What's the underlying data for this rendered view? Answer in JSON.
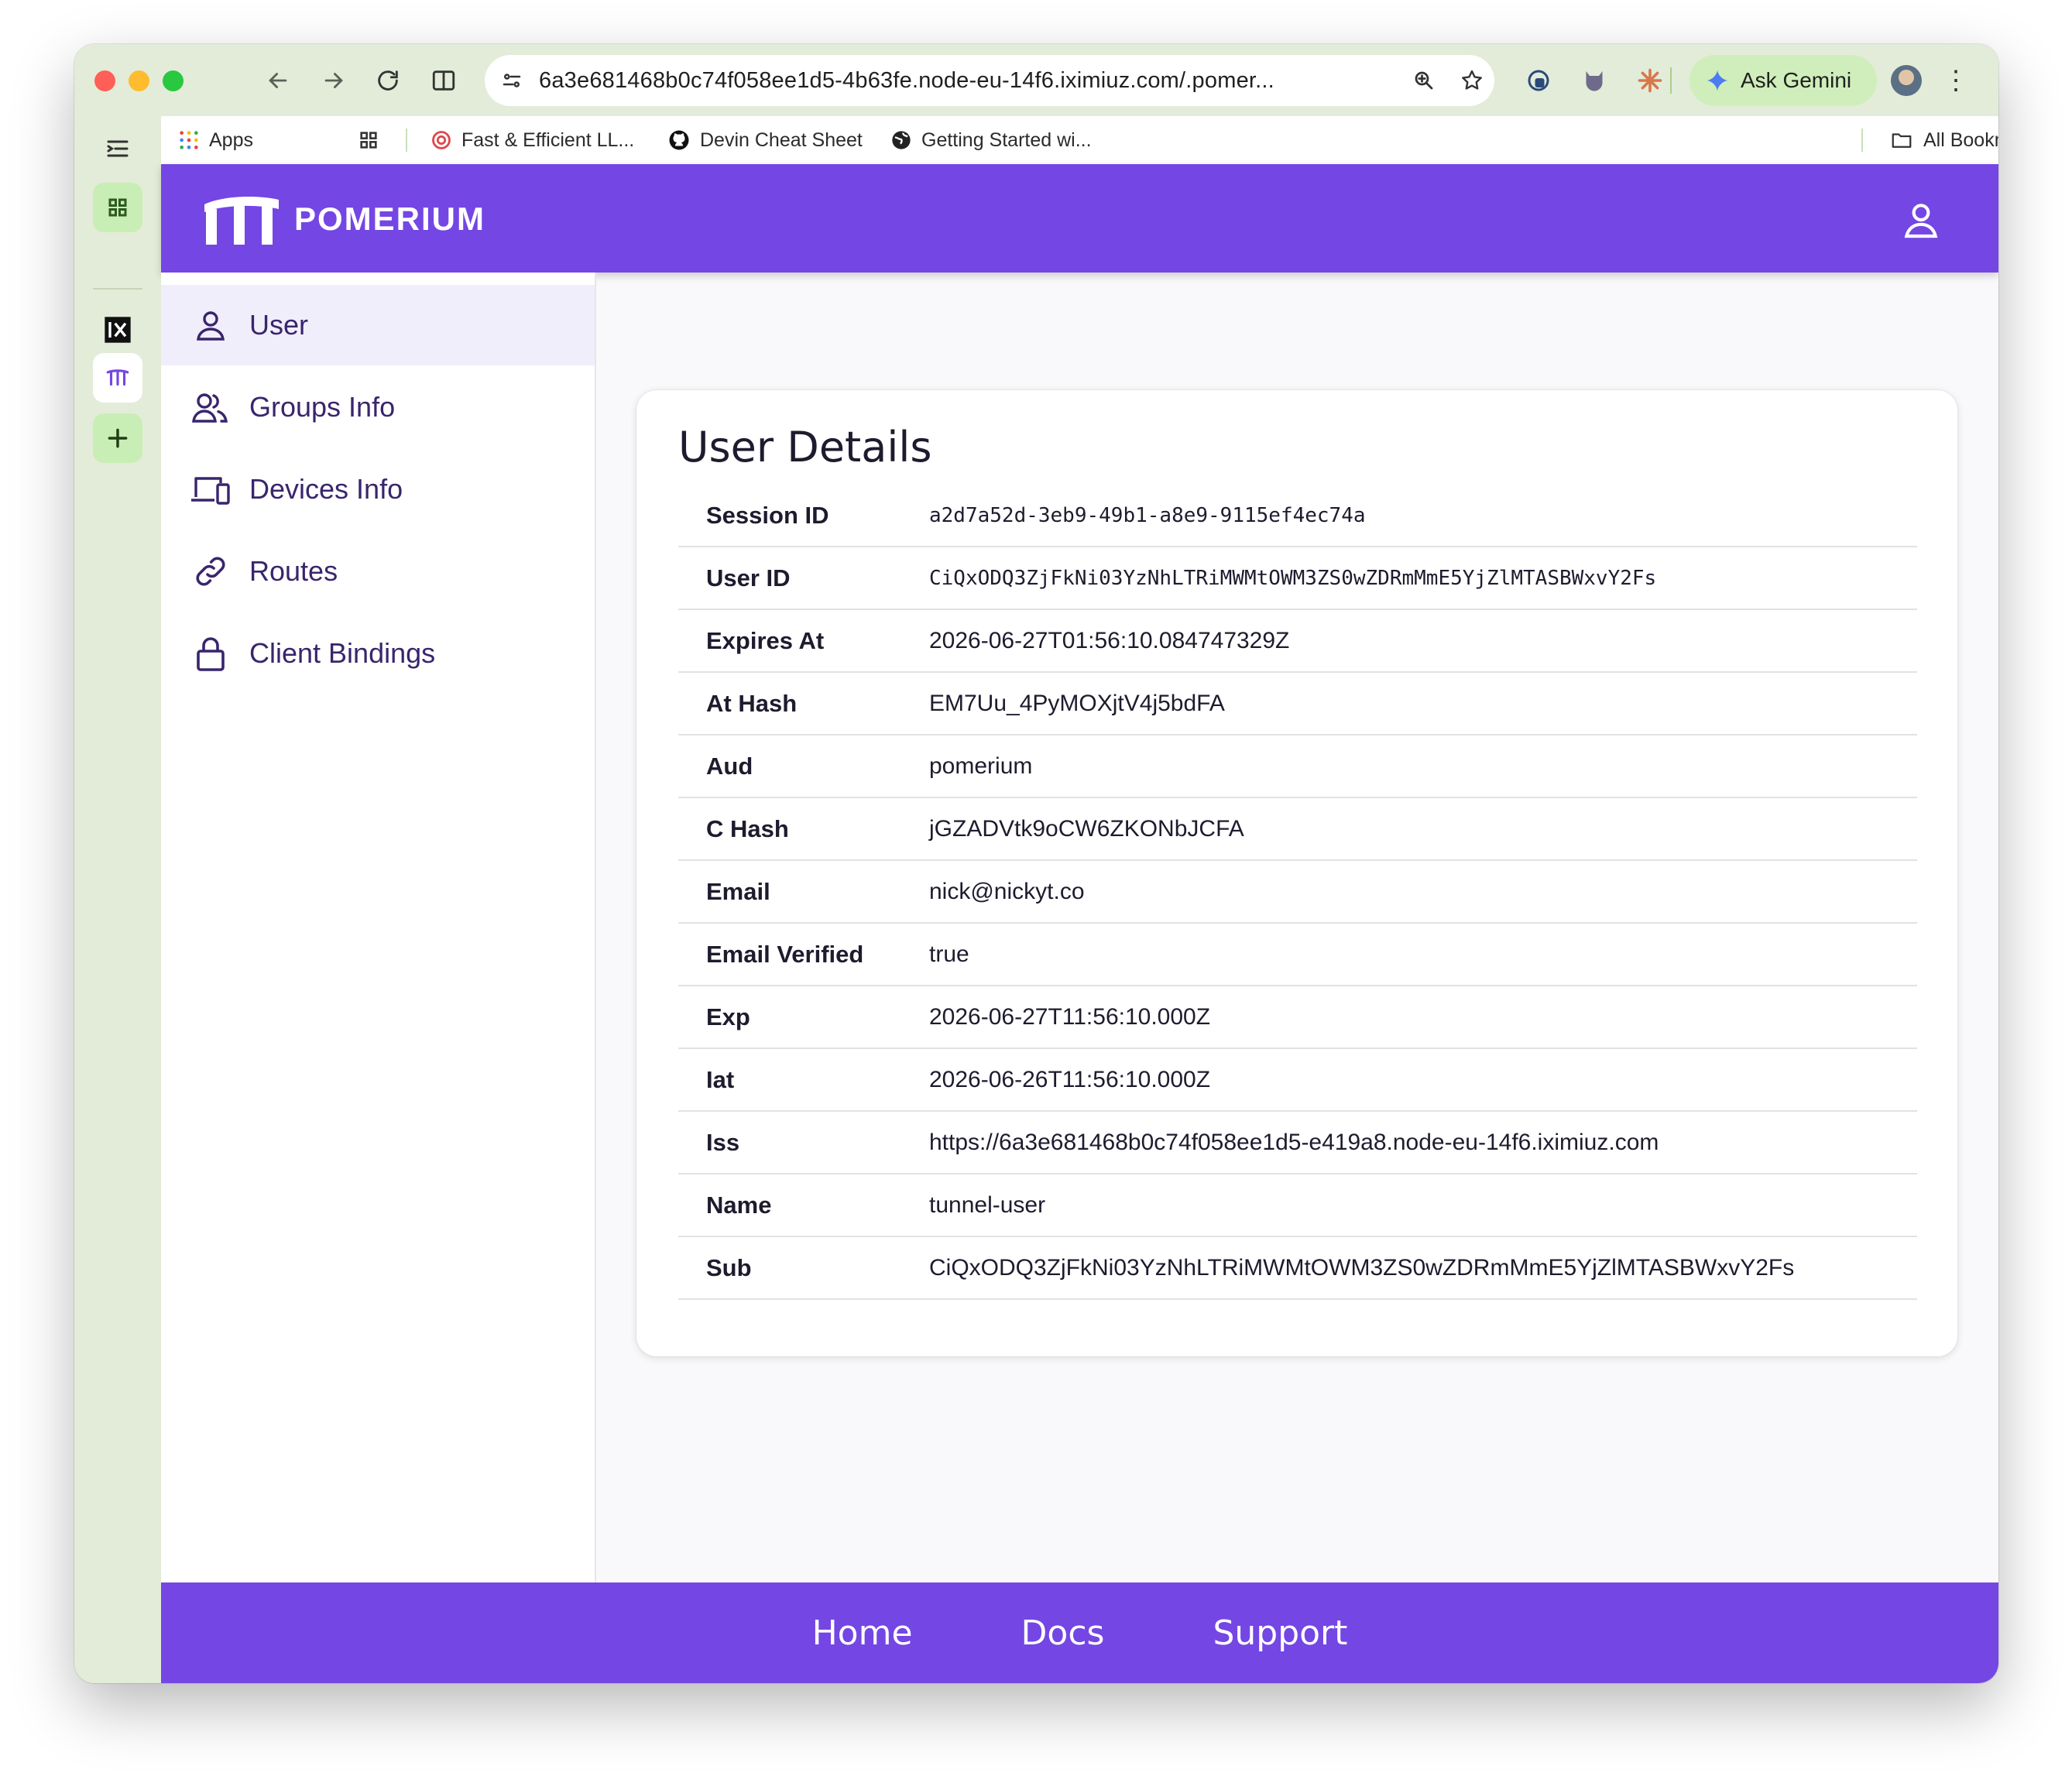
{
  "browser": {
    "url": "6a3e681468b0c74f058ee1d5-4b63fe.node-eu-14f6.iximiuz.com/.pomer...",
    "ask_gemini": "Ask Gemini",
    "bookmarks": [
      {
        "label": "Apps"
      },
      {
        "label": "Fast & Efficient LL..."
      },
      {
        "label": "Devin Cheat Sheet"
      },
      {
        "label": "Getting Started wi..."
      }
    ],
    "all_bookmarks": "All Bookmarks"
  },
  "app": {
    "brand": "POMERIUM",
    "nav": [
      {
        "label": "User",
        "icon": "user-icon",
        "active": true
      },
      {
        "label": "Groups Info",
        "icon": "groups-icon"
      },
      {
        "label": "Devices Info",
        "icon": "devices-icon"
      },
      {
        "label": "Routes",
        "icon": "link-icon"
      },
      {
        "label": "Client Bindings",
        "icon": "lock-icon"
      }
    ],
    "card_title": "User Details",
    "details": [
      {
        "key": "Session ID",
        "value": "a2d7a52d-3eb9-49b1-a8e9-9115ef4ec74a"
      },
      {
        "key": "User ID",
        "value": "CiQxODQ3ZjFkNi03YzNhLTRiMWMtOWM3ZS0wZDRmMmE5YjZlMTASBWxvY2Fs"
      },
      {
        "key": "Expires At",
        "value": "2026-06-27T01:56:10.084747329Z"
      },
      {
        "key": "At Hash",
        "value": "EM7Uu_4PyMOXjtV4j5bdFA"
      },
      {
        "key": "Aud",
        "value": "pomerium"
      },
      {
        "key": "C Hash",
        "value": "jGZADVtk9oCW6ZKONbJCFA"
      },
      {
        "key": "Email",
        "value": "nick@nickyt.co"
      },
      {
        "key": "Email Verified",
        "value": "true"
      },
      {
        "key": "Exp",
        "value": "2026-06-27T11:56:10.000Z"
      },
      {
        "key": "Iat",
        "value": "2026-06-26T11:56:10.000Z"
      },
      {
        "key": "Iss",
        "value": "https://6a3e681468b0c74f058ee1d5-e419a8.node-eu-14f6.iximiuz.com"
      },
      {
        "key": "Name",
        "value": "tunnel-user"
      },
      {
        "key": "Sub",
        "value": "CiQxODQ3ZjFkNi03YzNhLTRiMWMtOWM3ZS0wZDRmMmE5YjZlMTASBWxvY2Fs"
      }
    ],
    "footer": [
      {
        "label": "Home"
      },
      {
        "label": "Docs"
      },
      {
        "label": "Support"
      }
    ]
  },
  "colors": {
    "brand_purple": "#7446e4",
    "nav_text": "#39256c",
    "active_bg": "#f1eefc",
    "chrome_green": "#e3ecd8"
  }
}
